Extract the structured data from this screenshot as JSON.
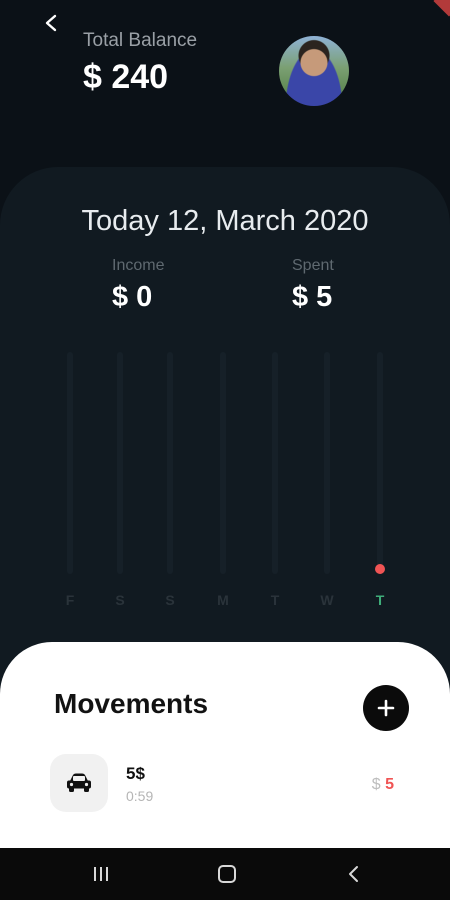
{
  "header": {
    "back_icon": "chevron-left-icon",
    "balance_label": "Total Balance",
    "balance_value": "$ 240",
    "avatar": "user-avatar-photo"
  },
  "summary": {
    "date_title": "Today 12, March 2020",
    "income_label": "Income",
    "income_value": "$ 0",
    "spent_label": "Spent",
    "spent_value": "$ 5"
  },
  "chart_data": {
    "type": "bar",
    "categories": [
      "F",
      "S",
      "S",
      "M",
      "T",
      "W",
      "T"
    ],
    "values": [
      0,
      0,
      0,
      0,
      0,
      0,
      5
    ],
    "active_index": 6,
    "colors": {
      "track": "#162028",
      "value": "#f05454",
      "active_label": "#3fae7a",
      "label": "#2a333a"
    }
  },
  "movements": {
    "title": "Movements",
    "add_icon": "plus-icon",
    "items": [
      {
        "icon": "car-icon",
        "title": "5$",
        "time": "0:59",
        "currency": "$",
        "amount": "5"
      }
    ]
  },
  "navbar": {
    "recent_icon": "recent-apps-icon",
    "home_icon": "home-icon",
    "back_icon": "back-nav-icon"
  },
  "colors": {
    "background": "#0b1117",
    "panel": "#111a21",
    "sheet": "#ffffff",
    "accent_red": "#f05454",
    "accent_green": "#3fae7a"
  }
}
